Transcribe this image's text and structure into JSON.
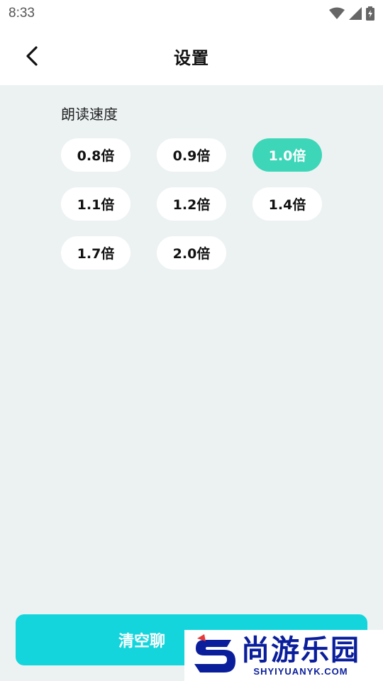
{
  "status_bar": {
    "time": "8:33",
    "icons": [
      "wifi-icon",
      "signal-icon",
      "battery-charging-icon"
    ]
  },
  "header": {
    "title": "设置",
    "back_icon": "chevron-left-icon"
  },
  "reading_speed": {
    "label": "朗读速度",
    "options": [
      {
        "label": "0.8倍",
        "selected": false
      },
      {
        "label": "0.9倍",
        "selected": false
      },
      {
        "label": "1.0倍",
        "selected": true
      },
      {
        "label": "1.1倍",
        "selected": false
      },
      {
        "label": "1.2倍",
        "selected": false
      },
      {
        "label": "1.4倍",
        "selected": false
      },
      {
        "label": "1.7倍",
        "selected": false
      },
      {
        "label": "2.0倍",
        "selected": false
      }
    ]
  },
  "footer": {
    "clear_button_label": "清空聊"
  },
  "watermark": {
    "cn": "尚游乐园",
    "en": "SHYIYUANYK.COM"
  },
  "colors": {
    "accent_selected": "#3dd6b8",
    "clear_button": "#14d5dc",
    "background": "#ecf2f2",
    "watermark_blue": "#0a1e9c",
    "watermark_red": "#e63a3a"
  }
}
